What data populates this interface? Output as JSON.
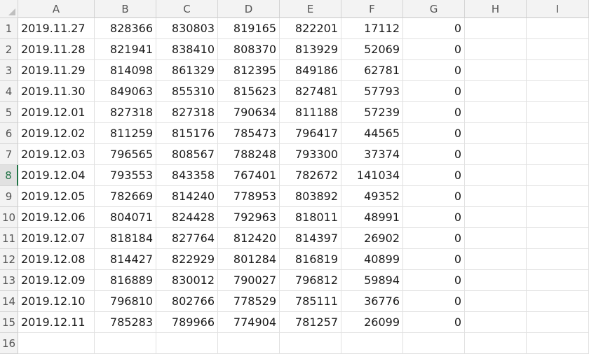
{
  "columns": [
    "A",
    "B",
    "C",
    "D",
    "E",
    "F",
    "G",
    "H",
    "I"
  ],
  "active_row": 8,
  "rows": [
    {
      "n": "1",
      "A": "2019.11.27",
      "B": "828366",
      "C": "830803",
      "D": "819165",
      "E": "822201",
      "F": "17112",
      "G": "0"
    },
    {
      "n": "2",
      "A": "2019.11.28",
      "B": "821941",
      "C": "838410",
      "D": "808370",
      "E": "813929",
      "F": "52069",
      "G": "0"
    },
    {
      "n": "3",
      "A": "2019.11.29",
      "B": "814098",
      "C": "861329",
      "D": "812395",
      "E": "849186",
      "F": "62781",
      "G": "0"
    },
    {
      "n": "4",
      "A": "2019.11.30",
      "B": "849063",
      "C": "855310",
      "D": "815623",
      "E": "827481",
      "F": "57793",
      "G": "0"
    },
    {
      "n": "5",
      "A": "2019.12.01",
      "B": "827318",
      "C": "827318",
      "D": "790634",
      "E": "811188",
      "F": "57239",
      "G": "0"
    },
    {
      "n": "6",
      "A": "2019.12.02",
      "B": "811259",
      "C": "815176",
      "D": "785473",
      "E": "796417",
      "F": "44565",
      "G": "0"
    },
    {
      "n": "7",
      "A": "2019.12.03",
      "B": "796565",
      "C": "808567",
      "D": "788248",
      "E": "793300",
      "F": "37374",
      "G": "0"
    },
    {
      "n": "8",
      "A": "2019.12.04",
      "B": "793553",
      "C": "843358",
      "D": "767401",
      "E": "782672",
      "F": "141034",
      "G": "0"
    },
    {
      "n": "9",
      "A": "2019.12.05",
      "B": "782669",
      "C": "814240",
      "D": "778953",
      "E": "803892",
      "F": "49352",
      "G": "0"
    },
    {
      "n": "10",
      "A": "2019.12.06",
      "B": "804071",
      "C": "824428",
      "D": "792963",
      "E": "818011",
      "F": "48991",
      "G": "0"
    },
    {
      "n": "11",
      "A": "2019.12.07",
      "B": "818184",
      "C": "827764",
      "D": "812420",
      "E": "814397",
      "F": "26902",
      "G": "0"
    },
    {
      "n": "12",
      "A": "2019.12.08",
      "B": "814427",
      "C": "822929",
      "D": "801284",
      "E": "816819",
      "F": "40899",
      "G": "0"
    },
    {
      "n": "13",
      "A": "2019.12.09",
      "B": "816889",
      "C": "830012",
      "D": "790027",
      "E": "796812",
      "F": "59894",
      "G": "0"
    },
    {
      "n": "14",
      "A": "2019.12.10",
      "B": "796810",
      "C": "802766",
      "D": "778529",
      "E": "785111",
      "F": "36776",
      "G": "0"
    },
    {
      "n": "15",
      "A": "2019.12.11",
      "B": "785283",
      "C": "789966",
      "D": "774904",
      "E": "781257",
      "F": "26099",
      "G": "0"
    },
    {
      "n": "16",
      "A": "",
      "B": "",
      "C": "",
      "D": "",
      "E": "",
      "F": "",
      "G": ""
    }
  ]
}
